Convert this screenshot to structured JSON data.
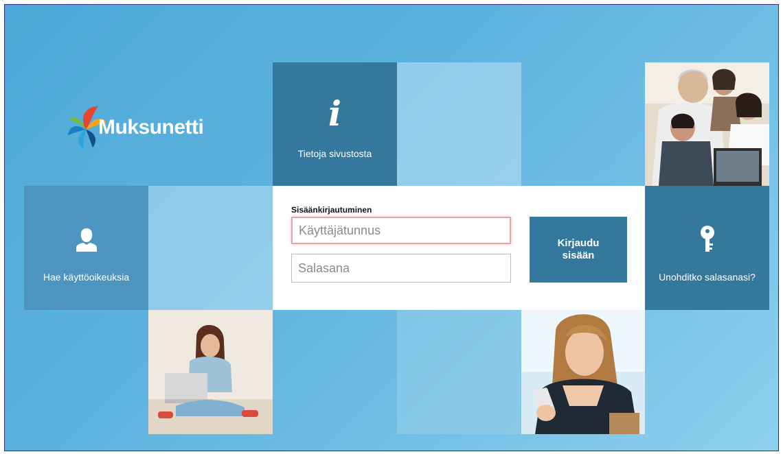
{
  "logo": {
    "text": "Muksunetti"
  },
  "tiles": {
    "info": {
      "label": "Tietoja sivustosta",
      "icon": "info-icon"
    },
    "apply": {
      "label": "Hae käyttöoikeuksia",
      "icon": "user-icon"
    },
    "forgot": {
      "label": "Unohditko salasanasi?",
      "icon": "key-icon"
    }
  },
  "login": {
    "heading": "Sisäänkirjautuminen",
    "username_placeholder": "Käyttäjätunnus",
    "password_placeholder": "Salasana",
    "submit_label": "Kirjaudu sisään"
  },
  "colors": {
    "tile_dark": "#35789e",
    "tile_mid": "#4b95c0",
    "background": "#5cb2de",
    "focus_border": "#e8a3a8"
  }
}
